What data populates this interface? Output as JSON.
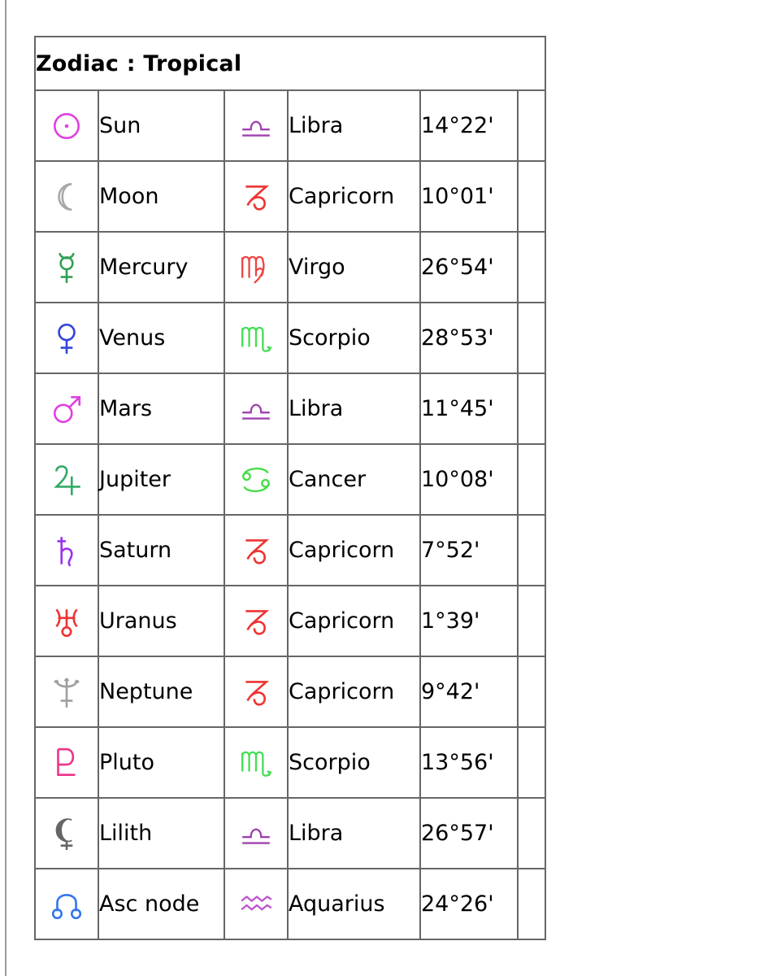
{
  "table": {
    "title": "Zodiac : Tropical",
    "rows": [
      {
        "planet": "Sun",
        "planet_icon": "sun-icon",
        "planet_color": "#e040e0",
        "sign": "Libra",
        "sign_icon": "libra-icon",
        "sign_color": "#a040b0",
        "degree": "14°22'"
      },
      {
        "planet": "Moon",
        "planet_icon": "moon-icon",
        "planet_color": "#a8a8a8",
        "sign": "Capricorn",
        "sign_icon": "capricorn-icon",
        "sign_color": "#ee3333",
        "degree": "10°01'"
      },
      {
        "planet": "Mercury",
        "planet_icon": "mercury-icon",
        "planet_color": "#33a055",
        "sign": "Virgo",
        "sign_icon": "virgo-icon",
        "sign_color": "#ee4444",
        "degree": "26°54'"
      },
      {
        "planet": "Venus",
        "planet_icon": "venus-icon",
        "planet_color": "#3344dd",
        "sign": "Scorpio",
        "sign_icon": "scorpio-icon",
        "sign_color": "#44dd55",
        "degree": "28°53'"
      },
      {
        "planet": "Mars",
        "planet_icon": "mars-icon",
        "planet_color": "#e040e0",
        "sign": "Libra",
        "sign_icon": "libra-icon",
        "sign_color": "#a040b0",
        "degree": "11°45'"
      },
      {
        "planet": "Jupiter",
        "planet_icon": "jupiter-icon",
        "planet_color": "#33aa66",
        "sign": "Cancer",
        "sign_icon": "cancer-icon",
        "sign_color": "#44dd44",
        "degree": "10°08'"
      },
      {
        "planet": "Saturn",
        "planet_icon": "saturn-icon",
        "planet_color": "#9933ee",
        "sign": "Capricorn",
        "sign_icon": "capricorn-icon",
        "sign_color": "#ee3333",
        "degree": "7°52'"
      },
      {
        "planet": "Uranus",
        "planet_icon": "uranus-icon",
        "planet_color": "#ee3333",
        "sign": "Capricorn",
        "sign_icon": "capricorn-icon",
        "sign_color": "#ee3333",
        "degree": "1°39'"
      },
      {
        "planet": "Neptune",
        "planet_icon": "neptune-icon",
        "planet_color": "#a0a0a0",
        "sign": "Capricorn",
        "sign_icon": "capricorn-icon",
        "sign_color": "#ee3333",
        "degree": "9°42'"
      },
      {
        "planet": "Pluto",
        "planet_icon": "pluto-icon",
        "planet_color": "#ee3388",
        "sign": "Scorpio",
        "sign_icon": "scorpio-icon",
        "sign_color": "#44dd55",
        "degree": "13°56'"
      },
      {
        "planet": "Lilith",
        "planet_icon": "lilith-icon",
        "planet_color": "#666666",
        "sign": "Libra",
        "sign_icon": "libra-icon",
        "sign_color": "#a040b0",
        "degree": "26°57'"
      },
      {
        "planet": "Asc node",
        "planet_icon": "asc-node-icon",
        "planet_color": "#3377ee",
        "sign": "Aquarius",
        "sign_icon": "aquarius-icon",
        "sign_color": "#bb55cc",
        "degree": "24°26'"
      }
    ]
  }
}
